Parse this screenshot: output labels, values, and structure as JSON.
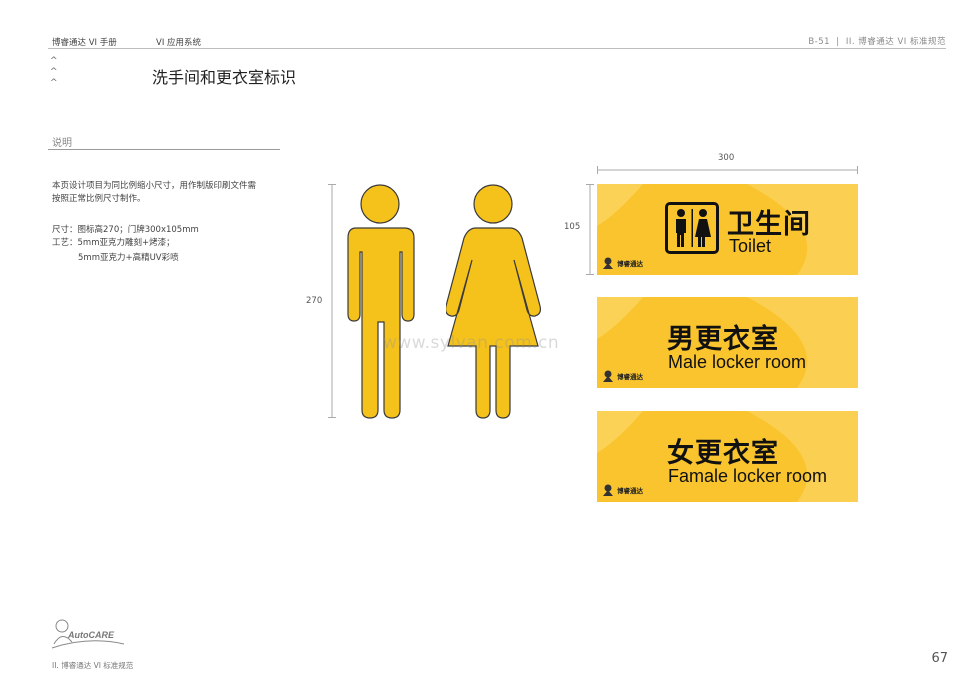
{
  "header": {
    "brand_manual": "博睿通达 VI 手册",
    "section": "VI 应用系统",
    "code": "B-51",
    "divider": "|",
    "category": "II. 博睿通达 VI 标准规范"
  },
  "nav_chevrons": [
    "^",
    "^",
    "^"
  ],
  "page_title": "洗手间和更衣室标识",
  "description": {
    "label": "说明",
    "para1_line1": "本页设计项目为同比例缩小尺寸，用作制版印刷文件需",
    "para1_line2": "按照正常比例尺寸制作。",
    "size_line": "尺寸：图标高270；门牌300x105mm",
    "craft_line1": "工艺：5mm亚克力雕刻+烤漆；",
    "craft_line2": "5mm亚克力+高精UV彩喷"
  },
  "dimensions": {
    "icon_height": "270",
    "sign_width": "300",
    "sign_height": "105"
  },
  "signs": [
    {
      "cn": "卫生间",
      "en": "Toilet",
      "logo": "博睿通达"
    },
    {
      "cn": "男更衣室",
      "en": "Male locker room",
      "logo": "博睿通达"
    },
    {
      "cn": "女更衣室",
      "en": "Famale locker room",
      "logo": "博睿通达"
    }
  ],
  "watermark": "www.sylvan.com.cn",
  "footer": {
    "logo_text": "AutoCARE",
    "category": "II. 博睿通达 VI 标准规范",
    "page_number": "67"
  },
  "colors": {
    "sign_yellow": "#f9c42e",
    "figure_yellow": "#f5c21b"
  },
  "icons": [
    "man-figure-icon",
    "woman-figure-icon",
    "restroom-icon",
    "logo-mascot-icon"
  ]
}
